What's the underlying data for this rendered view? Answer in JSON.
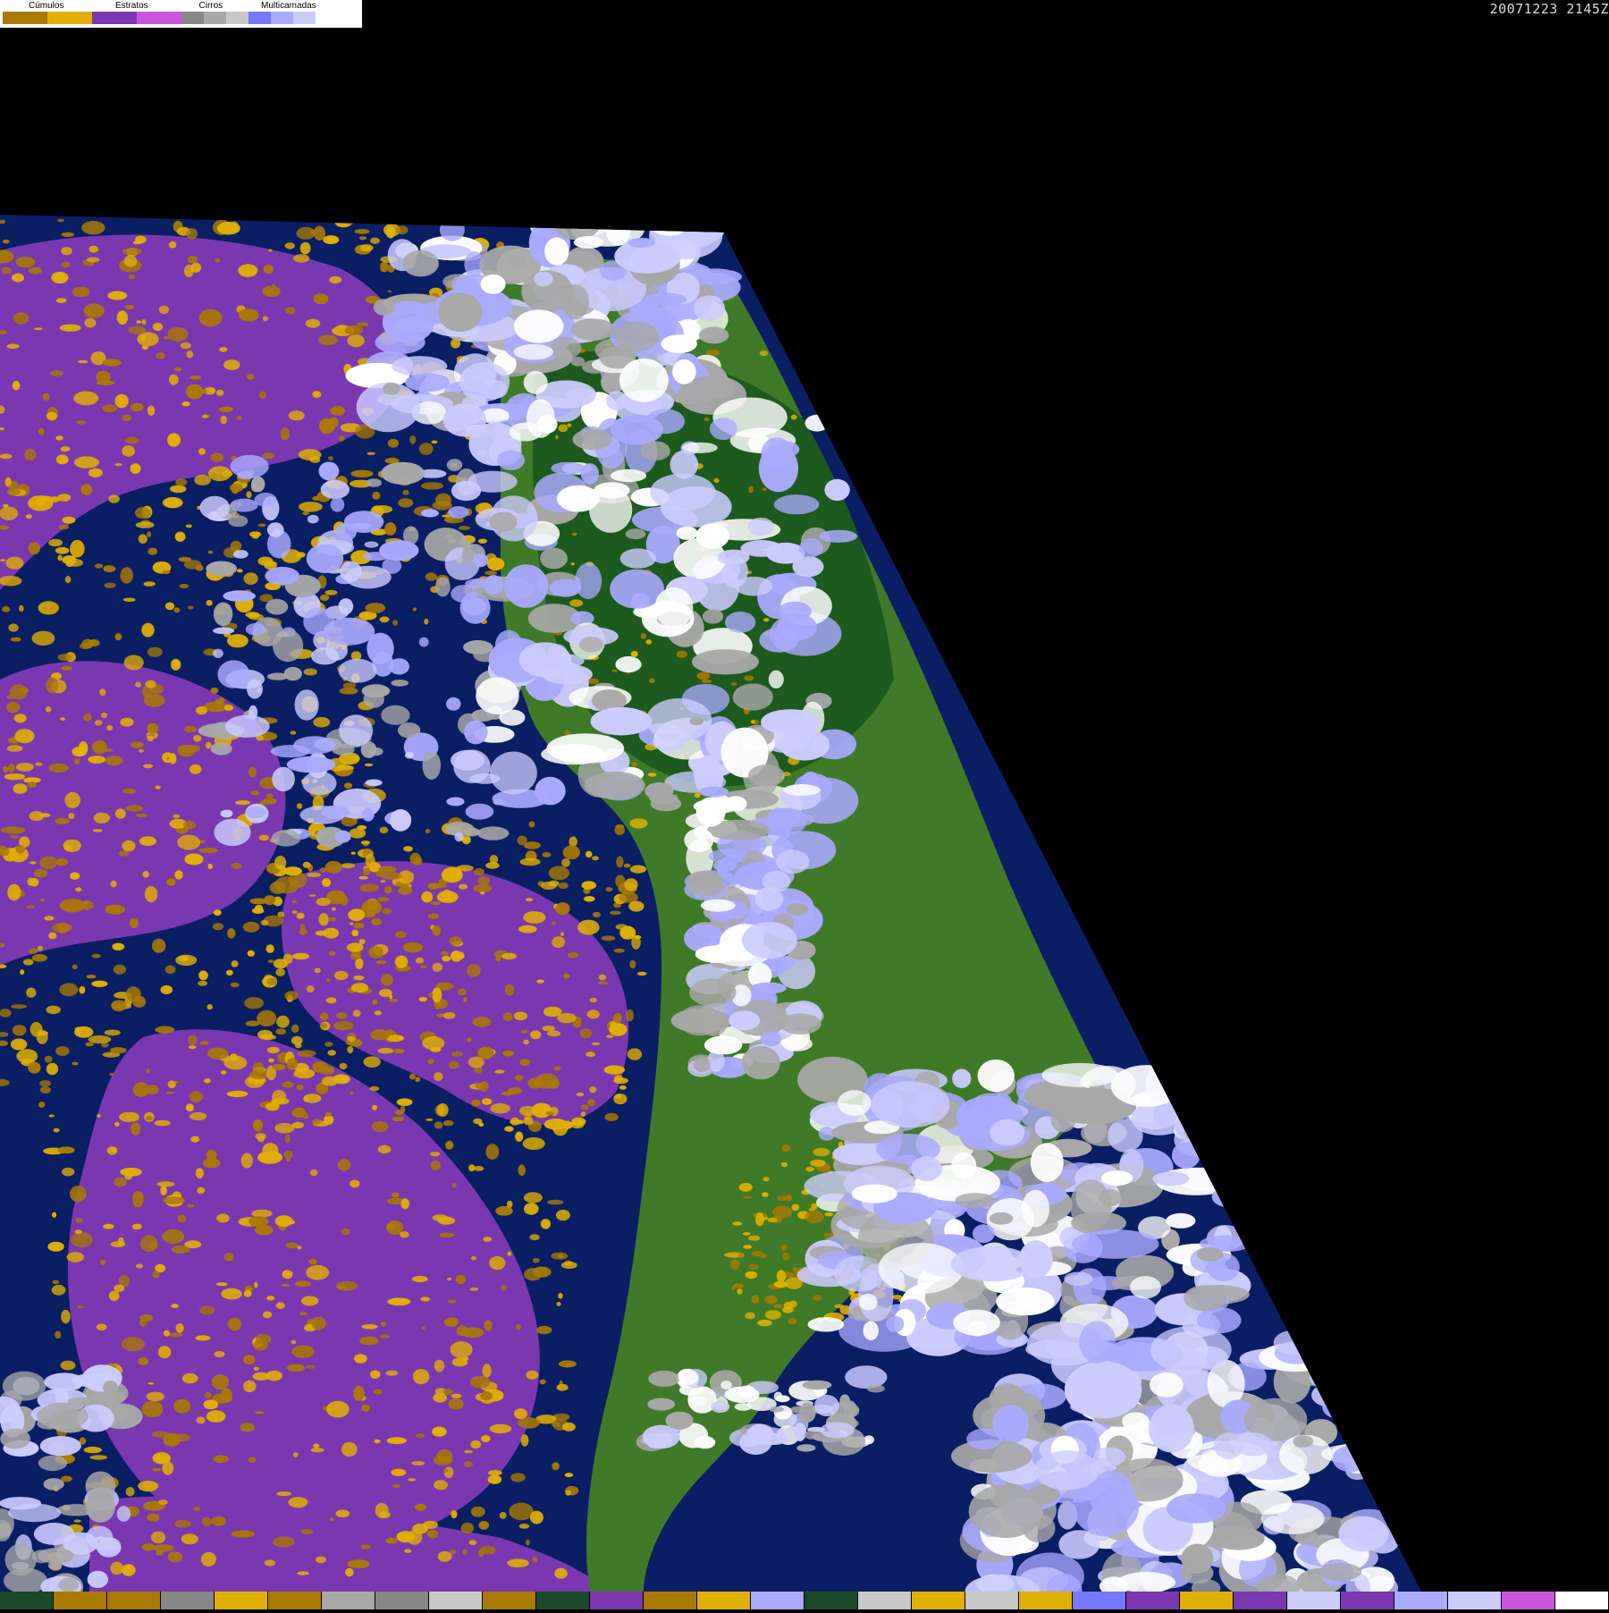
{
  "legend": {
    "groups": [
      {
        "label": "Cúmulos",
        "colors": [
          "#a87a00",
          "#e0b000"
        ]
      },
      {
        "label": "Estratos",
        "colors": [
          "#7a38b0",
          "#cc55dd"
        ]
      },
      {
        "label": "Cirros",
        "colors": [
          "#888888",
          "#a8a8a8",
          "#c8c8c8"
        ]
      },
      {
        "label": "Multicamadas",
        "colors": [
          "#7777ff",
          "#aaaaff",
          "#ccccff",
          "#ffffff"
        ]
      }
    ]
  },
  "timestamp": "20071223 2145Z",
  "colors": {
    "ocean": "#0a1e64",
    "land": "#3f7a28",
    "land_dark": "#1d5a1e",
    "cumulus_dark": "#a87a00",
    "cumulus_light": "#e0b000",
    "stratus": "#7a38b0",
    "stratus_light": "#cc55dd",
    "cirrus": "#a8a8a8",
    "multilayer": "#aaaaff",
    "multilayer_light": "#ccccff",
    "background": "#000000"
  },
  "bottom_strip": [
    "#1a4a2a",
    "#a87a00",
    "#a87a00",
    "#888888",
    "#e0b000",
    "#a87a00",
    "#a8a8a8",
    "#888888",
    "#c8c8c8",
    "#a87a00",
    "#1a4a2a",
    "#7a38b0",
    "#a87a00",
    "#e0b000",
    "#aaaaff",
    "#1a4a2a",
    "#c8c8c8",
    "#e0b000",
    "#c8c8c8",
    "#e0b000",
    "#7777ff",
    "#7a38b0",
    "#e0b000",
    "#7a38b0",
    "#ccccff",
    "#7a38b0",
    "#aaaaff",
    "#ccccff",
    "#cc55dd",
    "#ffffff"
  ]
}
